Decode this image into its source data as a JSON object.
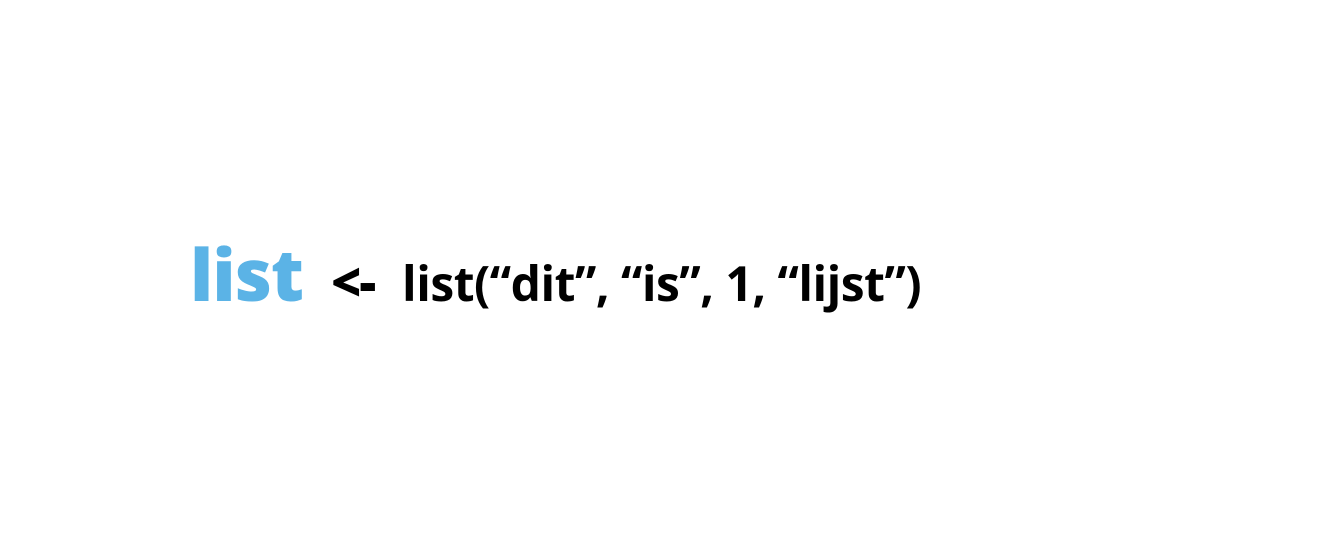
{
  "code": {
    "variable": "list",
    "operator": "<-",
    "expression": "list(“dit”, “is”, 1, “lijst”)"
  },
  "colors": {
    "variable": "#5bb3e6",
    "text": "#000000",
    "background": "#ffffff"
  }
}
